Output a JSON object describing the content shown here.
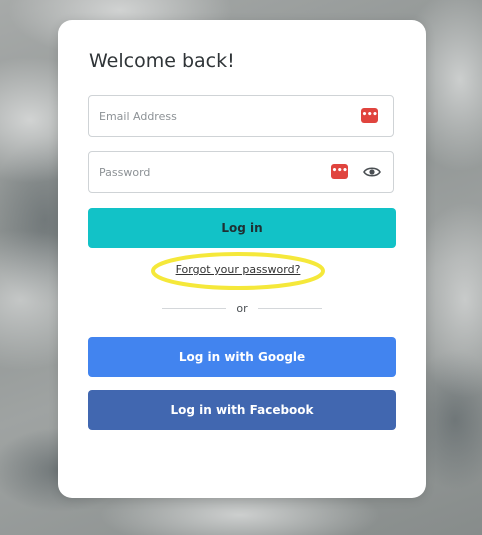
{
  "login": {
    "title": "Welcome back!",
    "email_placeholder": "Email Address",
    "password_placeholder": "Password",
    "login_label": "Log in",
    "forgot_label": "Forgot your password?",
    "or_label": "or",
    "google_label": "Log in with Google",
    "facebook_label": "Log in with Facebook"
  },
  "icons": {
    "email_manager": "password-manager-icon",
    "password_manager": "password-manager-icon",
    "password_toggle": "eye-icon"
  },
  "colors": {
    "login_button": "#12c2c7",
    "google_button": "#4284ef",
    "facebook_button": "#4167b0",
    "highlight": "#f5e83a",
    "password_manager": "#e0443e"
  }
}
